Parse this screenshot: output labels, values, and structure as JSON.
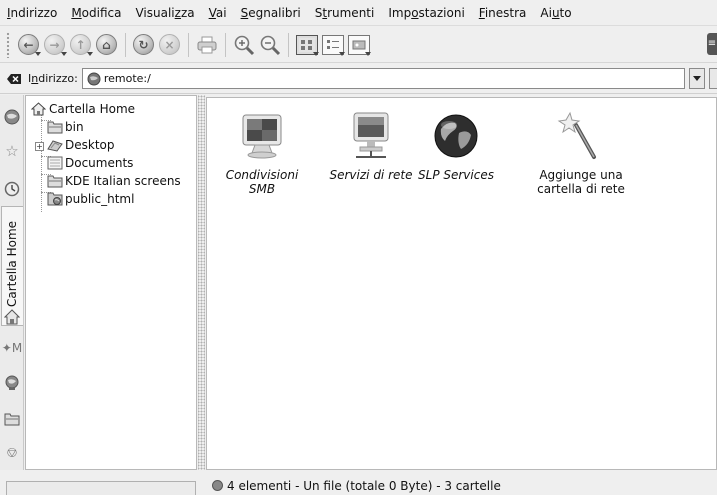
{
  "menubar": {
    "items": [
      {
        "pre": "",
        "key": "I",
        "post": "ndirizzo"
      },
      {
        "pre": "",
        "key": "M",
        "post": "odifica"
      },
      {
        "pre": "Visuali",
        "key": "z",
        "post": "za"
      },
      {
        "pre": "",
        "key": "V",
        "post": "ai"
      },
      {
        "pre": "",
        "key": "S",
        "post": "egnalibri"
      },
      {
        "pre": "S",
        "key": "t",
        "post": "rumenti"
      },
      {
        "pre": "Imp",
        "key": "o",
        "post": "stazioni"
      },
      {
        "pre": "",
        "key": "F",
        "post": "inestra"
      },
      {
        "pre": "Ai",
        "key": "u",
        "post": "to"
      }
    ]
  },
  "location": {
    "label_key": "n",
    "label_pre": "I",
    "label_post": "dirizzo:",
    "value": "remote:/"
  },
  "sidebar": {
    "active_tab_label": "Cartella Home"
  },
  "tree": {
    "root": "Cartella Home",
    "items": [
      "bin",
      "Desktop",
      "Documents",
      "KDE Italian screens",
      "public_html"
    ]
  },
  "files": [
    {
      "label": "Condivisioni SMB",
      "line1": "Condivisioni",
      "line2": "SMB",
      "italic": true,
      "icon": "monitor-icon"
    },
    {
      "label": "Servizi di rete",
      "line1": "Servizi di rete",
      "line2": "",
      "italic": true,
      "icon": "network-monitor-icon"
    },
    {
      "label": "SLP Services",
      "line1": "SLP Services",
      "line2": "",
      "italic": true,
      "icon": "globe-icon"
    },
    {
      "label": "Aggiunge una cartella di rete",
      "line1": "Aggiunge una",
      "line2": "cartella di rete",
      "italic": false,
      "icon": "wand-icon"
    }
  ],
  "status": {
    "text": "4 elementi - Un file (totale 0 Byte) - 3 cartelle"
  }
}
